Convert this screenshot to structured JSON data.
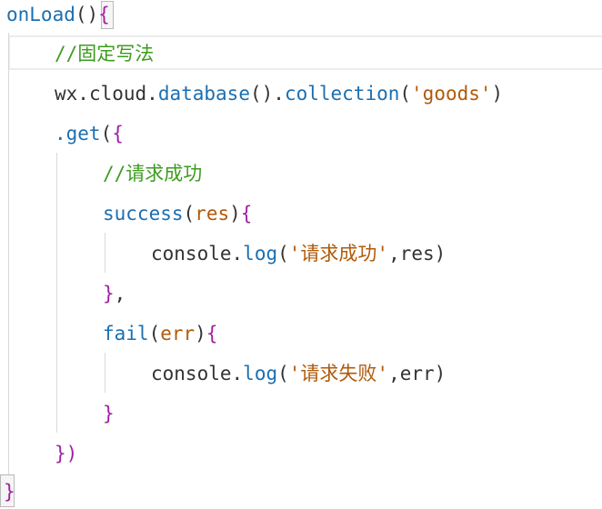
{
  "lines": {
    "l1": {
      "name": "onLoad",
      "open": "()",
      "brace": "{"
    },
    "l2": {
      "comment": "//固定写法"
    },
    "l3": {
      "obj": "wx",
      "dot1": ".",
      "cloud": "cloud",
      "dot2": ".",
      "database": "database",
      "paren1": "()",
      "dot3": ".",
      "collection": "collection",
      "lp": "(",
      "arg": "'goods'",
      "rp": ")"
    },
    "l4": {
      "get": ".get",
      "lp": "(",
      "brace": "{"
    },
    "l5": {
      "comment": "//请求成功"
    },
    "l6": {
      "name": "success",
      "lp": "(",
      "param": "res",
      "rp": ")",
      "brace": "{"
    },
    "l7": {
      "console": "console",
      "dot": ".",
      "log": "log",
      "lp": "(",
      "str": "'请求成功'",
      "rest": ",res",
      "rp": ")"
    },
    "l8": {
      "close": "}",
      "comma": ","
    },
    "l9": {
      "name": "fail",
      "lp": "(",
      "param": "err",
      "rp": ")",
      "brace": "{"
    },
    "l10": {
      "console": "console",
      "dot": ".",
      "log": "log",
      "lp": "(",
      "str": "'请求失败'",
      "rest": ",err",
      "rp": ")"
    },
    "l11": {
      "close": "}"
    },
    "l12": {
      "close": "})"
    },
    "l13": {
      "close": "}"
    }
  },
  "colors": {
    "function": "#1b6fb2",
    "brace": "#a020a0",
    "comment": "#3e9c1f",
    "string": "#b05a0a",
    "text": "#333333"
  }
}
